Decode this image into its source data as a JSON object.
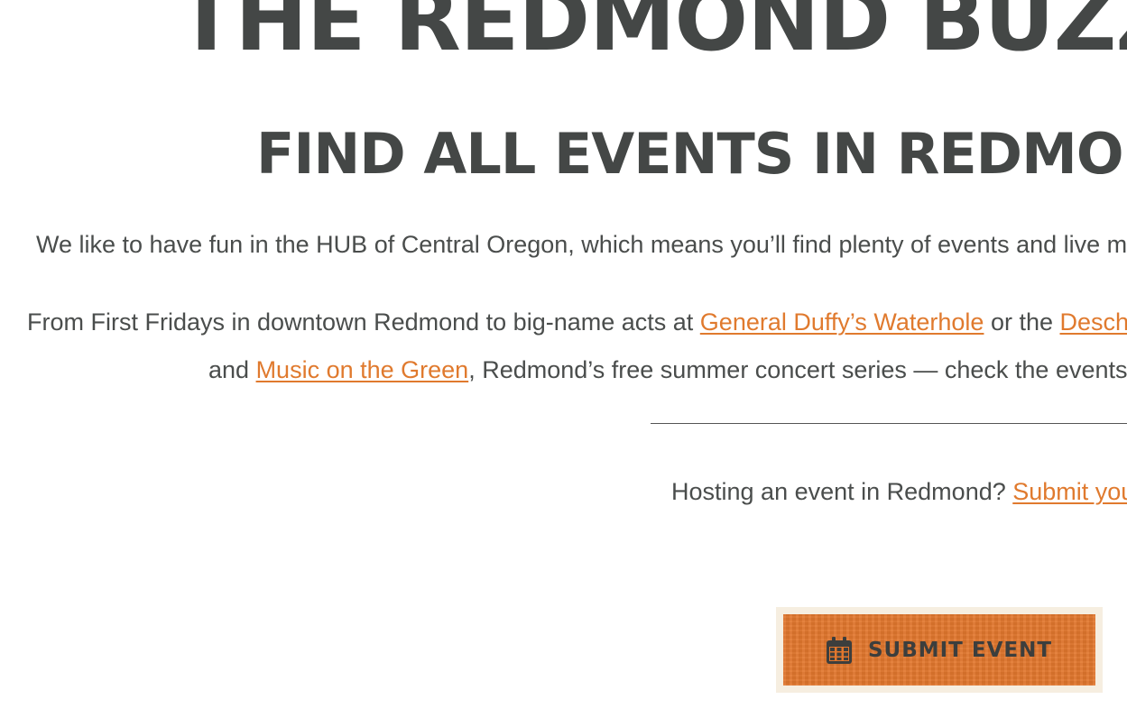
{
  "header": {
    "title": "THE REDMOND BUZZ EVE",
    "subtitle": "FIND ALL EVENTS IN REDMOND, OI"
  },
  "intro": {
    "line1": "We like to have fun in the HUB of Central Oregon, which means you’ll find plenty of events and live mu",
    "line2_prefix": "From First Fridays in downtown Redmond to big-name acts at ",
    "link_duffys": "General Duffy’s Waterhole",
    "line2_mid": " or the ",
    "link_deschutes": "Deschu",
    "line3_prefix": "and ",
    "link_music_green": "Music on the Green",
    "line3_suffix": ", Redmond’s free summer concert series — check the events c"
  },
  "hosting": {
    "prompt": "Hosting an event in Redmond? ",
    "link_submit": "Submit you"
  },
  "submit_button": {
    "label": "SUBMIT EVENT",
    "icon": "calendar-icon"
  },
  "colors": {
    "heading": "#444746",
    "text": "#4a4d4c",
    "link": "#e07a2e",
    "button_bg": "#e2772d",
    "button_frame": "#f6eee0"
  }
}
